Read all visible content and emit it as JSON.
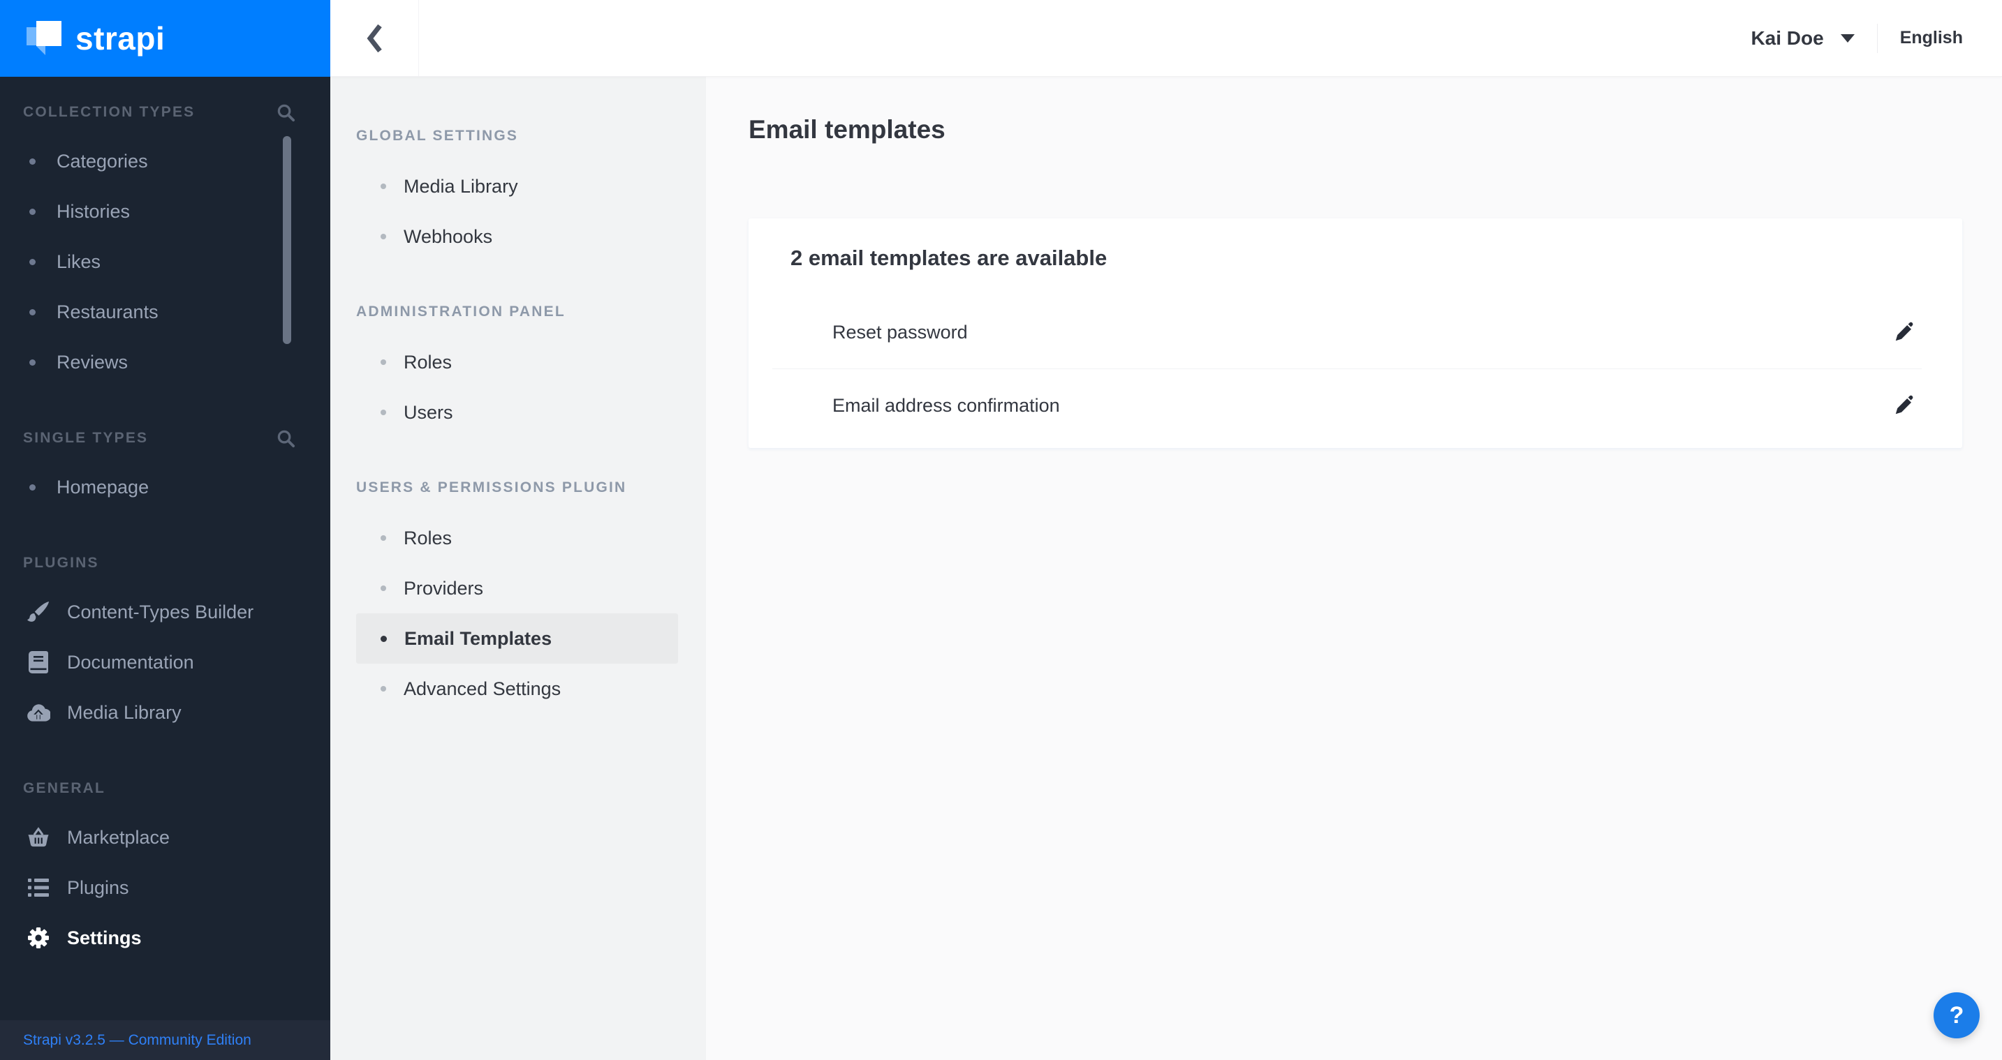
{
  "brand": {
    "logo_text": "strapi",
    "accent_color": "#007eff",
    "sidebar_bg": "#1b2431",
    "footer_bg": "#232b3a"
  },
  "main_sidebar": {
    "sections": [
      {
        "label": "COLLECTION TYPES",
        "has_search": true,
        "items": [
          {
            "label": "Categories"
          },
          {
            "label": "Histories"
          },
          {
            "label": "Likes"
          },
          {
            "label": "Restaurants"
          },
          {
            "label": "Reviews"
          }
        ]
      },
      {
        "label": "SINGLE TYPES",
        "has_search": true,
        "items": [
          {
            "label": "Homepage"
          }
        ]
      },
      {
        "label": "PLUGINS",
        "items": [
          {
            "label": "Content-Types Builder",
            "icon": "paintbrush-icon"
          },
          {
            "label": "Documentation",
            "icon": "book-icon"
          },
          {
            "label": "Media Library",
            "icon": "cloud-upload-icon"
          }
        ]
      },
      {
        "label": "GENERAL",
        "items": [
          {
            "label": "Marketplace",
            "icon": "basket-icon"
          },
          {
            "label": "Plugins",
            "icon": "list-icon"
          },
          {
            "label": "Settings",
            "icon": "gear-icon",
            "active": true
          }
        ]
      }
    ],
    "footer": {
      "version_text": "Strapi v3.2.5 — Community Edition",
      "link_color": "#2f80f6"
    }
  },
  "topbar": {
    "back_icon": "chevron-left-icon",
    "user_name": "Kai Doe",
    "locale_label": "English"
  },
  "settings_sidebar": {
    "sections": [
      {
        "label": "GLOBAL SETTINGS",
        "items": [
          {
            "label": "Media Library"
          },
          {
            "label": "Webhooks"
          }
        ]
      },
      {
        "label": "ADMINISTRATION PANEL",
        "items": [
          {
            "label": "Roles"
          },
          {
            "label": "Users"
          }
        ]
      },
      {
        "label": "USERS & PERMISSIONS PLUGIN",
        "items": [
          {
            "label": "Roles"
          },
          {
            "label": "Providers"
          },
          {
            "label": "Email Templates",
            "active": true
          },
          {
            "label": "Advanced Settings"
          }
        ],
        "highlight_color": "#e9eaeb"
      }
    ]
  },
  "content": {
    "page_title": "Email templates",
    "card": {
      "heading": "2 email templates are available",
      "rows": [
        {
          "label": "Reset password",
          "action_icon": "pencil-icon"
        },
        {
          "label": "Email address confirmation",
          "action_icon": "pencil-icon"
        }
      ]
    }
  },
  "help": {
    "label": "?",
    "bg_color": "#1b7de9"
  }
}
